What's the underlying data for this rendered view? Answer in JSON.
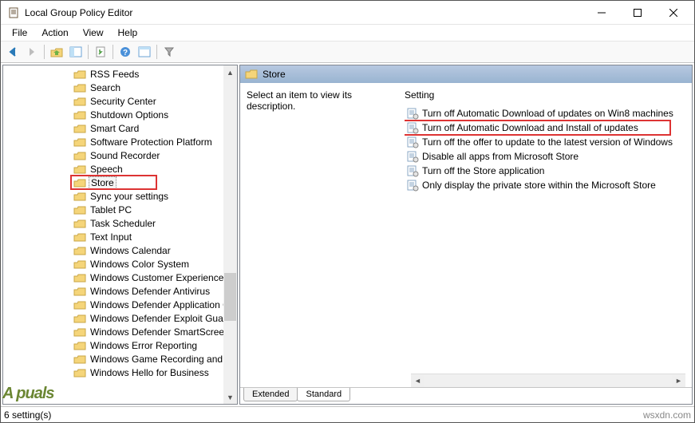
{
  "window": {
    "title": "Local Group Policy Editor"
  },
  "menubar": {
    "items": [
      "File",
      "Action",
      "View",
      "Help"
    ]
  },
  "tree": {
    "items": [
      {
        "label": "RSS Feeds"
      },
      {
        "label": "Search"
      },
      {
        "label": "Security Center"
      },
      {
        "label": "Shutdown Options"
      },
      {
        "label": "Smart Card"
      },
      {
        "label": "Software Protection Platform"
      },
      {
        "label": "Sound Recorder"
      },
      {
        "label": "Speech"
      },
      {
        "label": "Store",
        "selected": true,
        "highlighted": true
      },
      {
        "label": "Sync your settings"
      },
      {
        "label": "Tablet PC"
      },
      {
        "label": "Task Scheduler"
      },
      {
        "label": "Text Input"
      },
      {
        "label": "Windows Calendar"
      },
      {
        "label": "Windows Color System"
      },
      {
        "label": "Windows Customer Experience Im"
      },
      {
        "label": "Windows Defender Antivirus"
      },
      {
        "label": "Windows Defender Application G"
      },
      {
        "label": "Windows Defender Exploit Guard"
      },
      {
        "label": "Windows Defender SmartScreen"
      },
      {
        "label": "Windows Error Reporting"
      },
      {
        "label": "Windows Game Recording and Br"
      },
      {
        "label": "Windows Hello for Business"
      }
    ]
  },
  "details": {
    "title": "Store",
    "description_prompt": "Select an item to view its description.",
    "setting_header": "Setting",
    "settings": [
      {
        "label": "Turn off Automatic Download of updates on Win8 machines"
      },
      {
        "label": "Turn off Automatic Download and Install of updates",
        "highlighted": true
      },
      {
        "label": "Turn off the offer to update to the latest version of Windows"
      },
      {
        "label": "Disable all apps from Microsoft Store"
      },
      {
        "label": "Turn off the Store application"
      },
      {
        "label": "Only display the private store within the Microsoft Store"
      }
    ]
  },
  "tabs": {
    "extended": "Extended",
    "standard": "Standard"
  },
  "statusbar": {
    "text": "6 setting(s)",
    "right": "wsxdn.com"
  },
  "watermark": "A     puals"
}
